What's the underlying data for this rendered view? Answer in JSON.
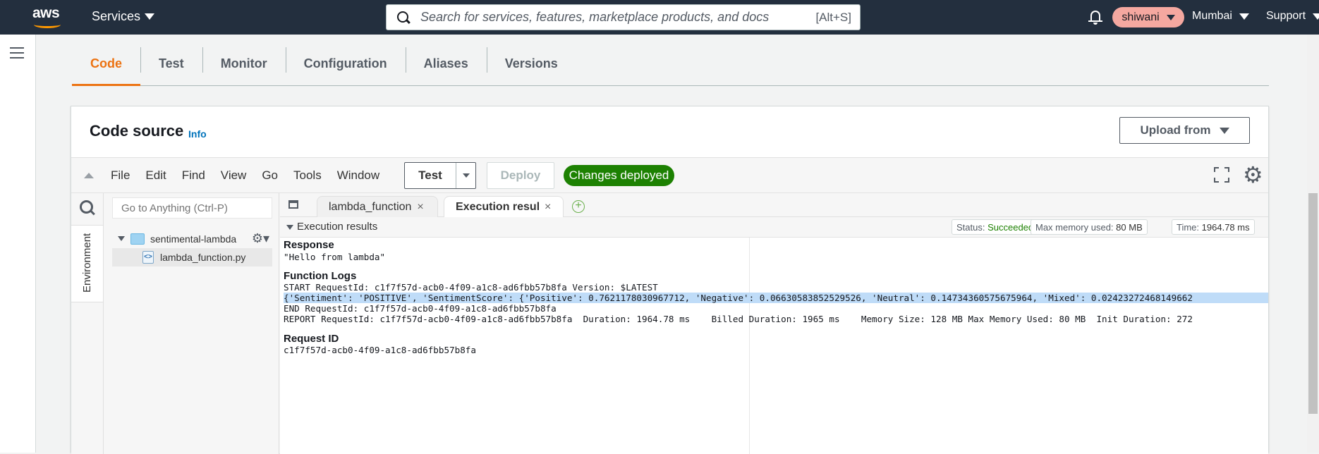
{
  "topnav": {
    "logo_text": "aws",
    "services_label": "Services",
    "search_placeholder": "Search for services, features, marketplace products, and docs",
    "search_shortcut": "[Alt+S]",
    "user": "shiwani",
    "region": "Mumbai",
    "support": "Support"
  },
  "tabs": [
    {
      "label": "Code",
      "active": true
    },
    {
      "label": "Test"
    },
    {
      "label": "Monitor"
    },
    {
      "label": "Configuration"
    },
    {
      "label": "Aliases"
    },
    {
      "label": "Versions"
    }
  ],
  "card": {
    "title": "Code source",
    "info": "Info",
    "upload_label": "Upload from"
  },
  "ide": {
    "menu": [
      "File",
      "Edit",
      "Find",
      "View",
      "Go",
      "Tools",
      "Window"
    ],
    "test_label": "Test",
    "deploy_label": "Deploy",
    "status_badge": "Changes deployed",
    "environment_label": "Environment",
    "goto_placeholder": "Go to Anything (Ctrl-P)",
    "folder": "sentimental-lambda",
    "file": "lambda_function.py",
    "editor_tabs": [
      {
        "label": "lambda_function",
        "active": false
      },
      {
        "label": "Execution results",
        "active": true
      }
    ],
    "results": {
      "title": "Execution results",
      "status_label": "Status:",
      "status_value": "Succeeded",
      "memory_label": "Max memory used:",
      "memory_value": "80 MB",
      "time_label": "Time:",
      "time_value": "1964.78 ms",
      "response_heading": "Response",
      "response_value": "\"Hello from lambda\"",
      "logs_heading": "Function Logs",
      "log_lines": [
        "START RequestId: c1f7f57d-acb0-4f09-a1c8-ad6fbb57b8fa Version: $LATEST",
        "{'Sentiment': 'POSITIVE', 'SentimentScore': {'Positive': 0.7621178030967712, 'Negative': 0.06630583852529526, 'Neutral': 0.14734360575675964, 'Mixed': 0.02423272468149662",
        "END RequestId: c1f7f57d-acb0-4f09-a1c8-ad6fbb57b8fa",
        "REPORT RequestId: c1f7f57d-acb0-4f09-a1c8-ad6fbb57b8fa  Duration: 1964.78 ms    Billed Duration: 1965 ms    Memory Size: 128 MB Max Memory Used: 80 MB  Init Duration: 272"
      ],
      "request_heading": "Request ID",
      "request_id": "c1f7f57d-acb0-4f09-a1c8-ad6fbb57b8fa"
    }
  },
  "colors": {
    "nav_bg": "#232f3e",
    "accent": "#ec7211",
    "success": "#1d8102",
    "user_pill": "#f5a8a0"
  }
}
